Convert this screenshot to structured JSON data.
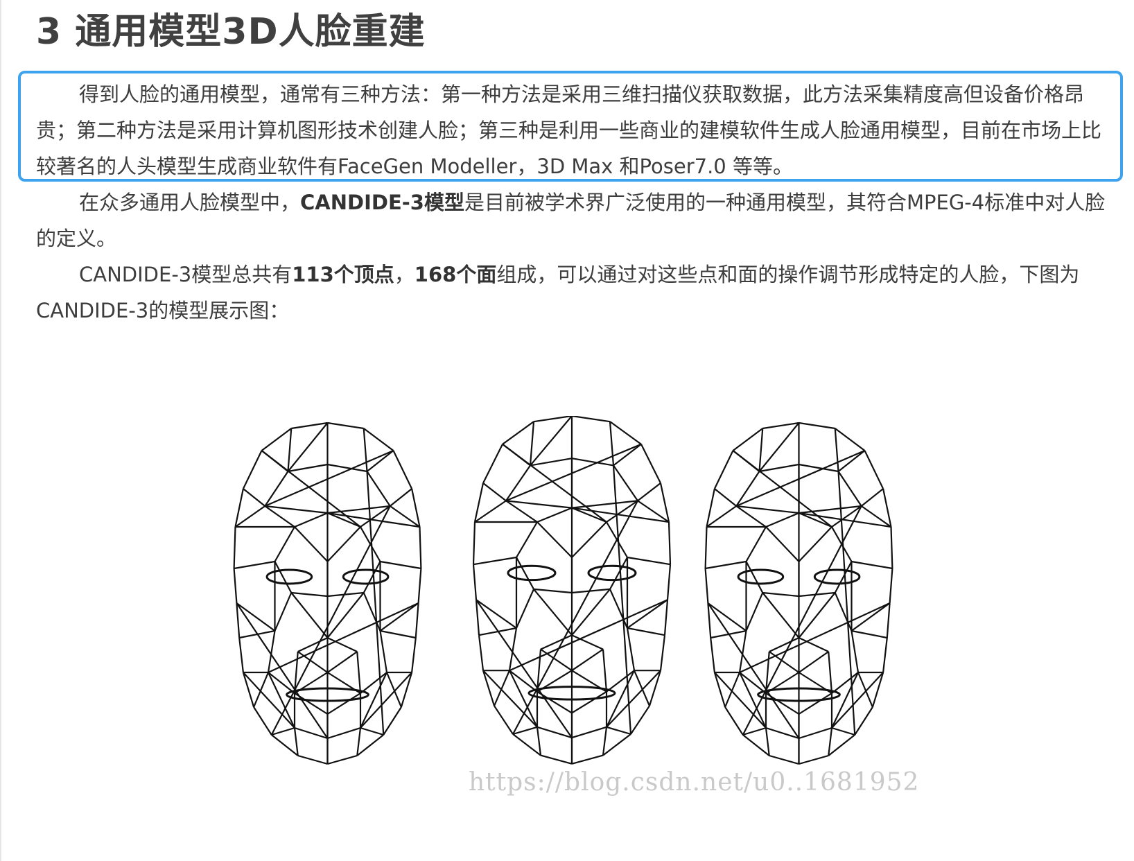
{
  "heading": "3 通用模型3D人脸重建",
  "paragraphs": {
    "p1": "得到人脸的通用模型，通常有三种方法：第一种方法是采用三维扫描仪获取数据，此方法采集精度高但设备价格昂贵；第二种方法是采用计算机图形技术创建人脸；第三种是利用一些商业的建模软件生成人脸通用模型，目前在市场上比较著名的人头模型生成商业软件有FaceGen Modeller，3D Max 和Poser7.0 等等。",
    "p2_a": "在众多通用人脸模型中，",
    "p2_bold": "CANDIDE-3模型",
    "p2_b": "是目前被学术界广泛使用的一种通用模型，其符合MPEG-4标准中对人脸的定义。",
    "p3_a": "CANDIDE-3模型总共有",
    "p3_bold1": "113个顶点",
    "p3_sep": "，",
    "p3_bold2": "168个面",
    "p3_b": "组成，可以通过对这些点和面的操作调节形成特定的人脸，下图为CANDIDE-3的模型展示图："
  },
  "figure": {
    "watermark": "https://blog.csdn.net/u0..1681952"
  },
  "colors": {
    "highlight_border": "#3ea3ee",
    "text": "#3d3d3d",
    "heading": "#404040"
  }
}
